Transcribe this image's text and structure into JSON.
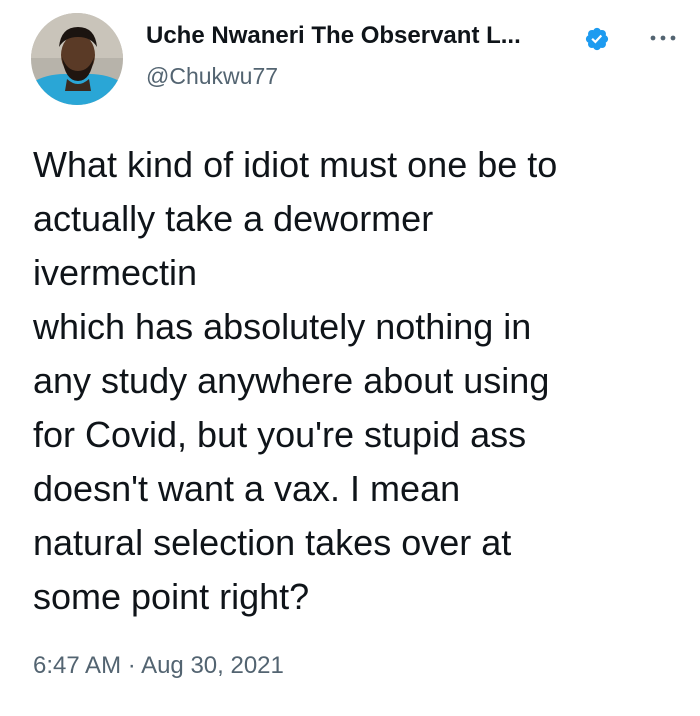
{
  "tweet": {
    "author": {
      "name": "Uche Nwaneri The Observant L...",
      "handle": "@Chukwu77",
      "verified": true,
      "avatar_icon": "profile-photo"
    },
    "more_icon": "ellipsis-icon",
    "text_lines": [
      "What kind of idiot must one be to",
      "actually take a dewormer",
      "ivermectin",
      "which has absolutely nothing in",
      "any study anywhere about using",
      "for Covid, but you're stupid ass",
      "doesn't want a vax. I mean",
      "natural selection takes over at",
      "some point right?"
    ],
    "time": "6:47 AM",
    "separator": "·",
    "date": "Aug 30, 2021"
  },
  "colors": {
    "text_primary": "#0f1419",
    "text_secondary": "#536471",
    "verified_blue": "#1d9bf0",
    "background": "#ffffff"
  }
}
